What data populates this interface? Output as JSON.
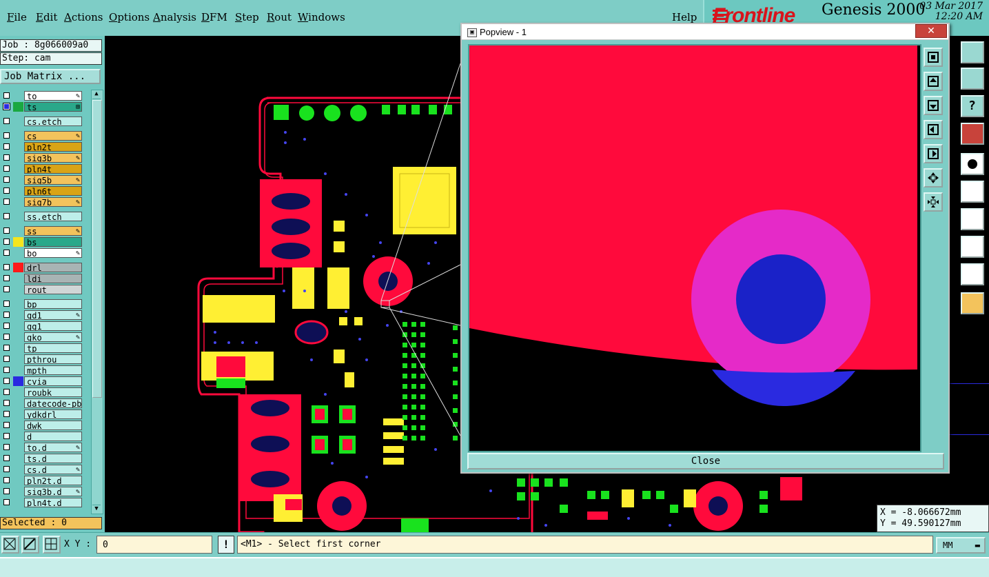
{
  "menu": {
    "items": [
      {
        "label": "File",
        "ul": "F",
        "rest": "ile"
      },
      {
        "label": "Edit",
        "ul": "E",
        "rest": "dit"
      },
      {
        "label": "Actions",
        "ul": "A",
        "rest": "ctions"
      },
      {
        "label": "Options",
        "ul": "O",
        "rest": "ptions"
      },
      {
        "label": "Analysis",
        "ul": "A",
        "rest": "nalysis"
      },
      {
        "label": "DFM",
        "ul": "D",
        "rest": "FM"
      },
      {
        "label": "Step",
        "ul": "S",
        "rest": "tep"
      },
      {
        "label": "Rout",
        "ul": "R",
        "rest": "out"
      },
      {
        "label": "Windows",
        "ul": "W",
        "rest": "indows"
      }
    ],
    "help": "Help"
  },
  "brand": {
    "logo": "Frontline",
    "product": "Genesis 2000",
    "date": "03 Mar 2017",
    "time": "12:20 AM"
  },
  "job": {
    "job_line": "Job : 8g066009a0",
    "step_line": "Step: cam",
    "matrix_button": "Job Matrix ..."
  },
  "layers": [
    {
      "name": "to",
      "bg": "#ffffff",
      "swatch": "",
      "mark": "✎"
    },
    {
      "name": "ts",
      "bg": "#2aa88a",
      "swatch": "#1aa840",
      "mark": "⊞",
      "checked": true
    },
    {
      "name": "cs.etch",
      "bg": "#bdeee9",
      "swatch": "",
      "mark": "",
      "gap": true
    },
    {
      "name": "cs",
      "bg": "#f3c35c",
      "swatch": "",
      "mark": "✎",
      "gap": true
    },
    {
      "name": "pln2t",
      "bg": "#d9a416",
      "swatch": "",
      "mark": ""
    },
    {
      "name": "sig3b",
      "bg": "#f3c35c",
      "swatch": "",
      "mark": "✎"
    },
    {
      "name": "pln4t",
      "bg": "#d9a416",
      "swatch": "",
      "mark": ""
    },
    {
      "name": "sig5b",
      "bg": "#f3c35c",
      "swatch": "",
      "mark": "✎"
    },
    {
      "name": "pln6t",
      "bg": "#d9a416",
      "swatch": "",
      "mark": ""
    },
    {
      "name": "sig7b",
      "bg": "#f3c35c",
      "swatch": "",
      "mark": "✎"
    },
    {
      "name": "ss.etch",
      "bg": "#bdeee9",
      "swatch": "",
      "mark": "",
      "gap": true
    },
    {
      "name": "ss",
      "bg": "#f3c35c",
      "swatch": "",
      "mark": "✎",
      "gap": true
    },
    {
      "name": "bs",
      "bg": "#2aa88a",
      "swatch": "#f5e51e",
      "mark": ""
    },
    {
      "name": "bo",
      "bg": "#ffffff",
      "swatch": "",
      "mark": "✎"
    },
    {
      "name": "drl",
      "bg": "#a8b4b4",
      "swatch": "#ff1a1a",
      "mark": "",
      "gap": true
    },
    {
      "name": "ldi",
      "bg": "#a8b4b4",
      "swatch": "",
      "mark": ""
    },
    {
      "name": "rout",
      "bg": "#cfd6d6",
      "swatch": "",
      "mark": ""
    },
    {
      "name": "bp",
      "bg": "#bdeee9",
      "swatch": "",
      "mark": "",
      "gap": true
    },
    {
      "name": "gd1",
      "bg": "#bdeee9",
      "swatch": "",
      "mark": "✎"
    },
    {
      "name": "gg1",
      "bg": "#bdeee9",
      "swatch": "",
      "mark": ""
    },
    {
      "name": "gko",
      "bg": "#bdeee9",
      "swatch": "",
      "mark": "✎"
    },
    {
      "name": "tp",
      "bg": "#bdeee9",
      "swatch": "",
      "mark": ""
    },
    {
      "name": "pthrou",
      "bg": "#bdeee9",
      "swatch": "",
      "mark": ""
    },
    {
      "name": "mpth",
      "bg": "#bdeee9",
      "swatch": "",
      "mark": ""
    },
    {
      "name": "cvia",
      "bg": "#bdeee9",
      "swatch": "#2a2ae0",
      "mark": ""
    },
    {
      "name": "roubk",
      "bg": "#bdeee9",
      "swatch": "",
      "mark": ""
    },
    {
      "name": "datecode-pbc",
      "bg": "#bdeee9",
      "swatch": "",
      "mark": ""
    },
    {
      "name": "ydkdrl",
      "bg": "#bdeee9",
      "swatch": "",
      "mark": ""
    },
    {
      "name": "dwk",
      "bg": "#bdeee9",
      "swatch": "",
      "mark": ""
    },
    {
      "name": "d",
      "bg": "#bdeee9",
      "swatch": "",
      "mark": ""
    },
    {
      "name": "to.d",
      "bg": "#bdeee9",
      "swatch": "",
      "mark": "✎"
    },
    {
      "name": "ts.d",
      "bg": "#bdeee9",
      "swatch": "",
      "mark": ""
    },
    {
      "name": "cs.d",
      "bg": "#bdeee9",
      "swatch": "",
      "mark": "✎"
    },
    {
      "name": "pln2t.d",
      "bg": "#bdeee9",
      "swatch": "",
      "mark": ""
    },
    {
      "name": "sig3b.d",
      "bg": "#bdeee9",
      "swatch": "",
      "mark": "✎"
    },
    {
      "name": "pln4t.d",
      "bg": "#bdeee9",
      "swatch": "",
      "mark": ""
    }
  ],
  "selected": "Selected : 0",
  "popview": {
    "title": "Popview - 1",
    "close_x": "✕",
    "close_button": "Close"
  },
  "coords": {
    "x": "X = -8.066672mm",
    "y": "Y =  49.590127mm"
  },
  "status": {
    "xy_label": "X Y :",
    "xy_value": "0",
    "warn": "!",
    "prompt": "<M1> - Select first corner",
    "units": "MM"
  },
  "colors": {
    "copper_red": "#ff0a3c",
    "pad_yellow": "#ffef33",
    "pad_green": "#19e21e",
    "drill_navy": "#0e0f55",
    "via_blue": "#1a22c8",
    "mask_magenta": "#e52ac8"
  }
}
